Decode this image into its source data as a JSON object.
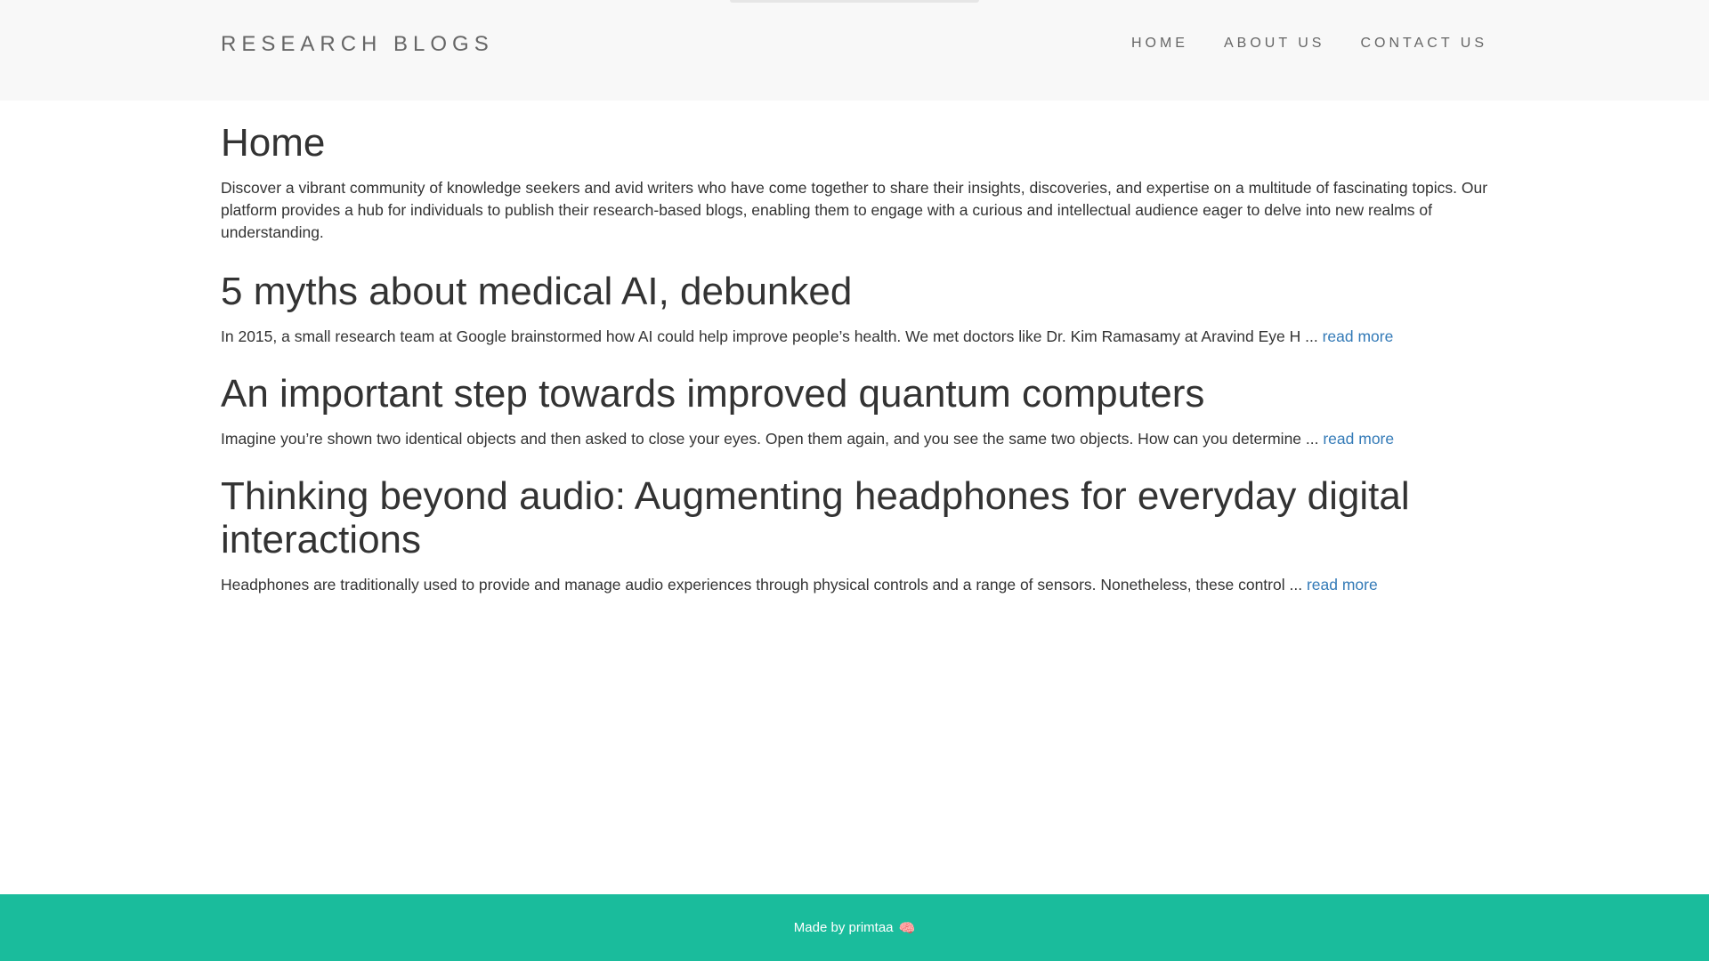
{
  "header": {
    "brand": "RESEARCH BLOGS",
    "nav": [
      "HOME",
      "ABOUT US",
      "CONTACT US"
    ]
  },
  "main": {
    "title": "Home",
    "intro": "Discover a vibrant community of knowledge seekers and avid writers who have come together to share their insights, discoveries, and expertise on a multitude of fascinating topics. Our platform provides a hub for individuals to publish their research-based blogs, enabling them to engage with a curious and intellectual audience eager to delve into new realms of understanding.",
    "posts": [
      {
        "title": "5 myths about medical AI, debunked",
        "excerpt": "In 2015, a small research team at Google brainstormed how AI could help improve people’s health. We met doctors like Dr. Kim Ramasamy at Aravind Eye H ...",
        "link": "read more"
      },
      {
        "title": "An important step towards improved quantum computers",
        "excerpt": "Imagine you’re shown two identical objects and then asked to close your eyes. Open them again, and you see the same two objects. How can you determine ...",
        "link": "read more"
      },
      {
        "title": "Thinking beyond audio: Augmenting headphones for everyday digital interactions",
        "excerpt": "Headphones are traditionally used to provide and manage audio experiences through physical controls and a range of sensors. Nonetheless, these control ...",
        "link": "read more"
      }
    ]
  },
  "footer": {
    "text": "Made by primtaa",
    "icon": "brain-icon",
    "icon_glyph": "🧠"
  },
  "colors": {
    "navbar_bg": "#f8f8f8",
    "footer_bg": "#1abc9c",
    "link": "#337ab7",
    "text": "#333333"
  }
}
